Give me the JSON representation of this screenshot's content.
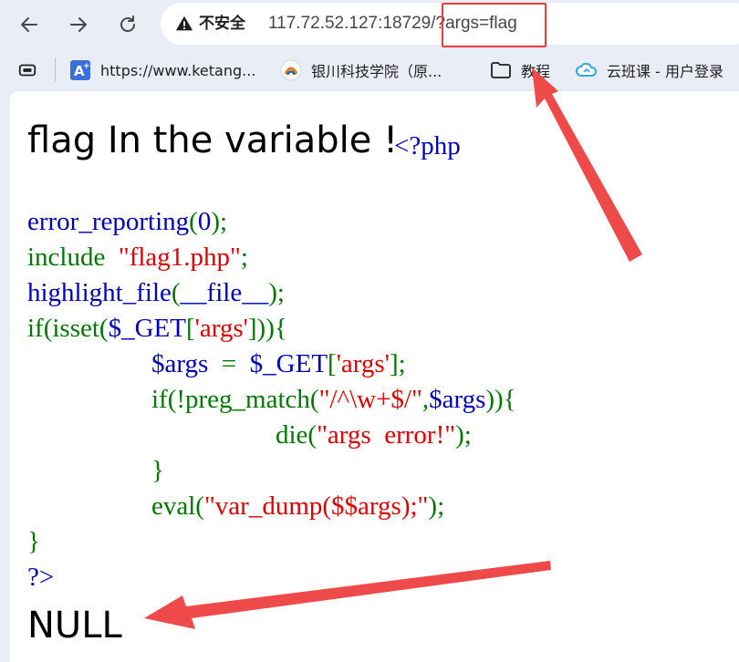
{
  "toolbar": {
    "back_icon": "arrow-left-icon",
    "forward_icon": "arrow-right-icon",
    "reload_icon": "reload-icon",
    "security_icon": "warning-triangle-icon",
    "security_label": "不安全",
    "url_host": "117.72.52.127:18729/",
    "url_query": "?args=flag"
  },
  "bookmarks": {
    "items": [
      {
        "label": "",
        "icon": "tab-search-icon"
      },
      {
        "label": "https://www.ketang...",
        "icon": "ketang-favicon"
      },
      {
        "label": "银川科技学院（原...",
        "icon": "college-favicon"
      },
      {
        "label": "教程",
        "icon": "folder-icon"
      },
      {
        "label": "云班课 - 用户登录",
        "icon": "cloud-favicon"
      }
    ]
  },
  "page": {
    "heading": "flag In the variable ! ",
    "php_open": "<?php",
    "code": {
      "l1_fn": "error_reporting",
      "l1_punct_open": "(",
      "l1_arg": "0",
      "l1_punct_close": ");",
      "l2_kw": "include  ",
      "l2_str": "\"flag1.php\"",
      "l2_end": ";",
      "l3_fn": "highlight_file",
      "l3_open": "(",
      "l3_arg": "__file__",
      "l3_close": ");",
      "l4_kw": "if(isset(",
      "l4_var": "$_GET",
      "l4_open": "[",
      "l4_str": "'args'",
      "l4_close": "])){",
      "l5_var1": "$args ",
      "l5_eq": " = ",
      "l5_var2": " $_GET",
      "l5_open": "[",
      "l5_str": "'args'",
      "l5_close": "];",
      "l6_kw": "if(!preg_match(",
      "l6_str": "\"/^\\w+$/\"",
      "l6_comma": ",",
      "l6_var": "$args",
      "l6_close": ")){",
      "l7_kw": "die(",
      "l7_str": "\"args  error!\"",
      "l7_close": ");",
      "l8_brace": "}",
      "l9_kw": "eval(",
      "l9_str": "\"var_dump($$args);\"",
      "l9_close": ");",
      "l10_brace": "}",
      "l11_close": "?>"
    },
    "output": "NULL"
  },
  "annotations": {
    "arrow_color": "#ee4a4a",
    "box_color": "#ee3b3b"
  }
}
